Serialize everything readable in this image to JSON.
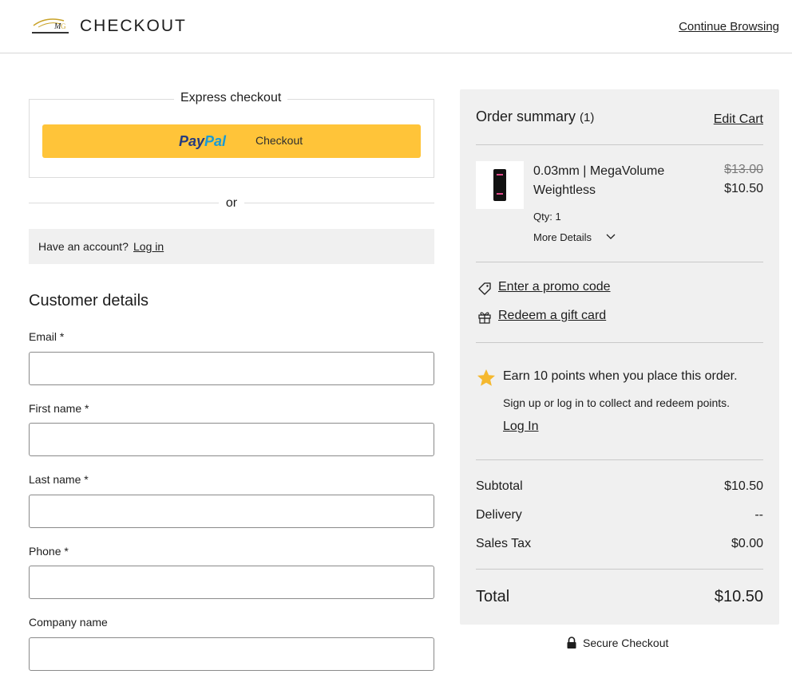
{
  "header": {
    "logo_icon": "brand-logo",
    "title": "CHECKOUT",
    "continue_label": "Continue Browsing"
  },
  "express": {
    "title": "Express checkout",
    "paypal_word1": "Pay",
    "paypal_word2": "Pal",
    "paypal_label": "Checkout",
    "paypal_color": "#ffc439"
  },
  "divider_or": "or",
  "account": {
    "prompt": "Have an account?",
    "login_label": "Log in"
  },
  "customer": {
    "title": "Customer details",
    "fields": [
      {
        "label": "Email *",
        "value": ""
      },
      {
        "label": "First name *",
        "value": ""
      },
      {
        "label": "Last name *",
        "value": ""
      },
      {
        "label": "Phone *",
        "value": ""
      },
      {
        "label": "Company name",
        "value": ""
      }
    ]
  },
  "summary": {
    "title": "Order summary",
    "count": "(1)",
    "edit_cart": "Edit Cart",
    "item": {
      "name": "0.03mm | MegaVolume Weightless",
      "price_original": "$13.00",
      "price_current": "$10.50",
      "qty": "Qty: 1",
      "more_details": "More Details"
    },
    "promo_label": "Enter a promo code",
    "gift_label": "Redeem a gift card",
    "loyalty": {
      "earn": "Earn 10 points when you place this order.",
      "signup": "Sign up or log in to collect and redeem points.",
      "login": "Log In",
      "star_color": "#f5b82e"
    },
    "lines": [
      {
        "label": "Subtotal",
        "value": "$10.50"
      },
      {
        "label": "Delivery",
        "value": "--"
      },
      {
        "label": "Sales Tax",
        "value": "$0.00"
      }
    ],
    "total_label": "Total",
    "total_value": "$10.50"
  },
  "secure_label": "Secure Checkout"
}
